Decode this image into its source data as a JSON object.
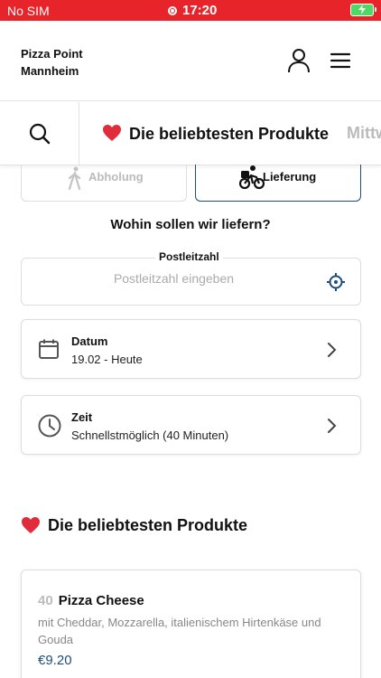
{
  "status_bar": {
    "carrier": "No SIM",
    "time": "17:20"
  },
  "header": {
    "store_name": "Pizza Point",
    "store_city": "Mannheim"
  },
  "category_tabs": {
    "active": "Die beliebtesten Produkte",
    "next": "Mittw"
  },
  "order_mode": {
    "pickup_label": "Abholung",
    "delivery_label": "Lieferung",
    "selected": "delivery"
  },
  "delivery": {
    "question": "Wohin sollen wir liefern?",
    "zip_label": "Postleitzahl",
    "zip_placeholder": "Postleitzahl eingeben",
    "zip_value": ""
  },
  "date": {
    "label": "Datum",
    "value": "19.02 - Heute"
  },
  "time": {
    "label": "Zeit",
    "value": "Schnellstmöglich (40 Minuten)"
  },
  "popular": {
    "title": "Die beliebtesten Produkte",
    "items": [
      {
        "number": "40",
        "name": "Pizza Cheese",
        "description": "mit Cheddar, Mozzarella, italienischem Hirtenkäse und Gouda",
        "price": "€9.20"
      }
    ]
  },
  "colors": {
    "status_bar": "#e8242b",
    "accent": "#1d4e79",
    "heart": "#e02c3b"
  }
}
